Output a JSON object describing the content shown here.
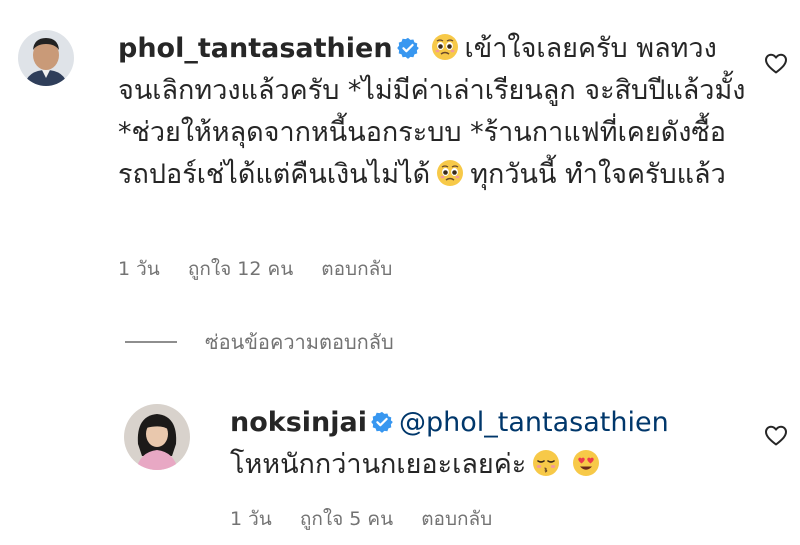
{
  "comment": {
    "username": "phol_tantasathien",
    "text_part1": "เข้าใจเลยครับ พลทวง จนเลิกทวงแล้วครับ *ไม่มีค่าเล่าเรียนลูก จะสิบปีแล้วมั้ง *ช่วยให้หลุดจากหนี้นอกระบบ *ร้านกาแฟที่เคยดังซื้อรถปอร์เช่ได้แต่คืนเงินไม่ได้",
    "text_part2": "ทุกวันนี้ ทำใจครับแล้ว",
    "time": "1 วัน",
    "likes": "ถูกใจ 12 คน",
    "reply_label": "ตอบกลับ"
  },
  "hide_replies_label": "ซ่อนข้อความตอบกลับ",
  "reply": {
    "username": "noksinjai",
    "mention": "@phol_tantasathien",
    "text": "โหหนักกว่านกเยอะเลยค่ะ",
    "time": "1 วัน",
    "likes": "ถูกใจ 5 คน",
    "reply_label": "ตอบกลับ"
  },
  "icons": {
    "verified": "verified-badge-icon",
    "heart": "heart-outline-icon",
    "emoji_pleading": "pleading-face-emoji",
    "emoji_kiss": "kissing-face-emoji",
    "emoji_heart_eyes": "heart-eyes-emoji"
  },
  "colors": {
    "verified_blue": "#3897f0",
    "mention": "#00376b",
    "meta_gray": "#737373"
  }
}
